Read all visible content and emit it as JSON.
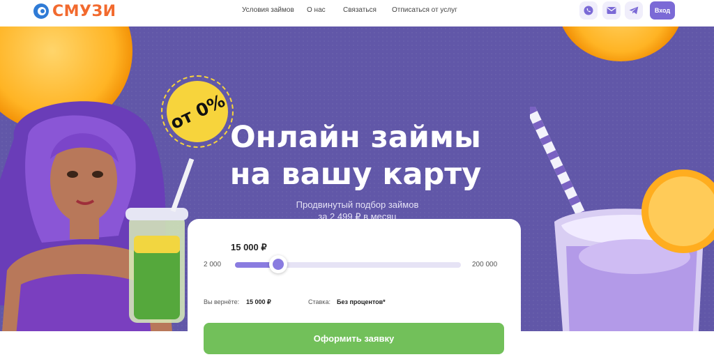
{
  "brand": {
    "name": "СМУЗИ",
    "accent": "#f26a2e",
    "mark_color": "#2f7bd6"
  },
  "nav": {
    "items": [
      {
        "label": "Условия займов"
      },
      {
        "label": "О нас"
      },
      {
        "label": "Связаться"
      },
      {
        "label": "Отписаться от услуг"
      }
    ]
  },
  "header": {
    "social": [
      "phone-icon",
      "mail-icon",
      "telegram-icon"
    ],
    "login_label": "Вход"
  },
  "hero": {
    "badge": "от 0%",
    "title_line1": "Онлайн займы",
    "title_line2": "на вашу карту",
    "subtitle_line1": "Продвинутый подбор займов",
    "subtitle_line2": "за 2 499 ₽ в месяц",
    "background": "#6157a8"
  },
  "calculator": {
    "amount": "15 000 ₽",
    "min_label": "2 000",
    "max_label": "200 000",
    "slider": {
      "min": 2000,
      "max": 200000,
      "value": 15000
    },
    "return_label": "Вы вернёте:",
    "return_value": "15 000 ₽",
    "rate_label": "Ставка:",
    "rate_value": "Без процентов*",
    "submit_label": "Оформить заявку",
    "button_color": "#72c05a"
  }
}
